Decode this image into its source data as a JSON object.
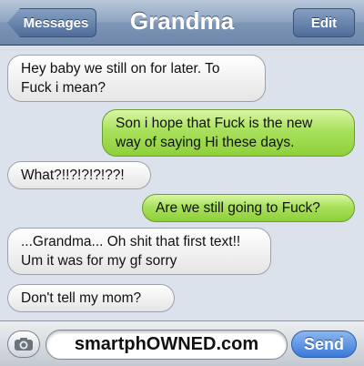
{
  "header": {
    "back_label": "Messages",
    "title": "Grandma",
    "edit_label": "Edit"
  },
  "messages": [
    {
      "direction": "received",
      "lines": [
        "Hey baby we still on for later. To",
        "Fuck i mean?"
      ]
    },
    {
      "direction": "sent",
      "lines": [
        "Son i hope that Fuck is the new",
        "way of saying Hi these days."
      ]
    },
    {
      "direction": "received",
      "lines": [
        "What?!!?!?!?!??!"
      ]
    },
    {
      "direction": "sent",
      "lines": [
        "Are we still going to Fuck?"
      ]
    },
    {
      "direction": "received",
      "lines": [
        "...Grandma... Oh shit that first text!!",
        "Um it was for my gf sorry"
      ]
    },
    {
      "direction": "received",
      "lines": [
        "Don't tell my mom?"
      ]
    }
  ],
  "composer": {
    "camera_icon": "camera-icon",
    "input_value": "smartphOWNED.com",
    "send_label": "Send"
  },
  "colors": {
    "sent_bubble": "#a8e05c",
    "received_bubble": "#f2f2f2",
    "background": "#dbe2ec",
    "send_button": "#3a7ad8"
  }
}
